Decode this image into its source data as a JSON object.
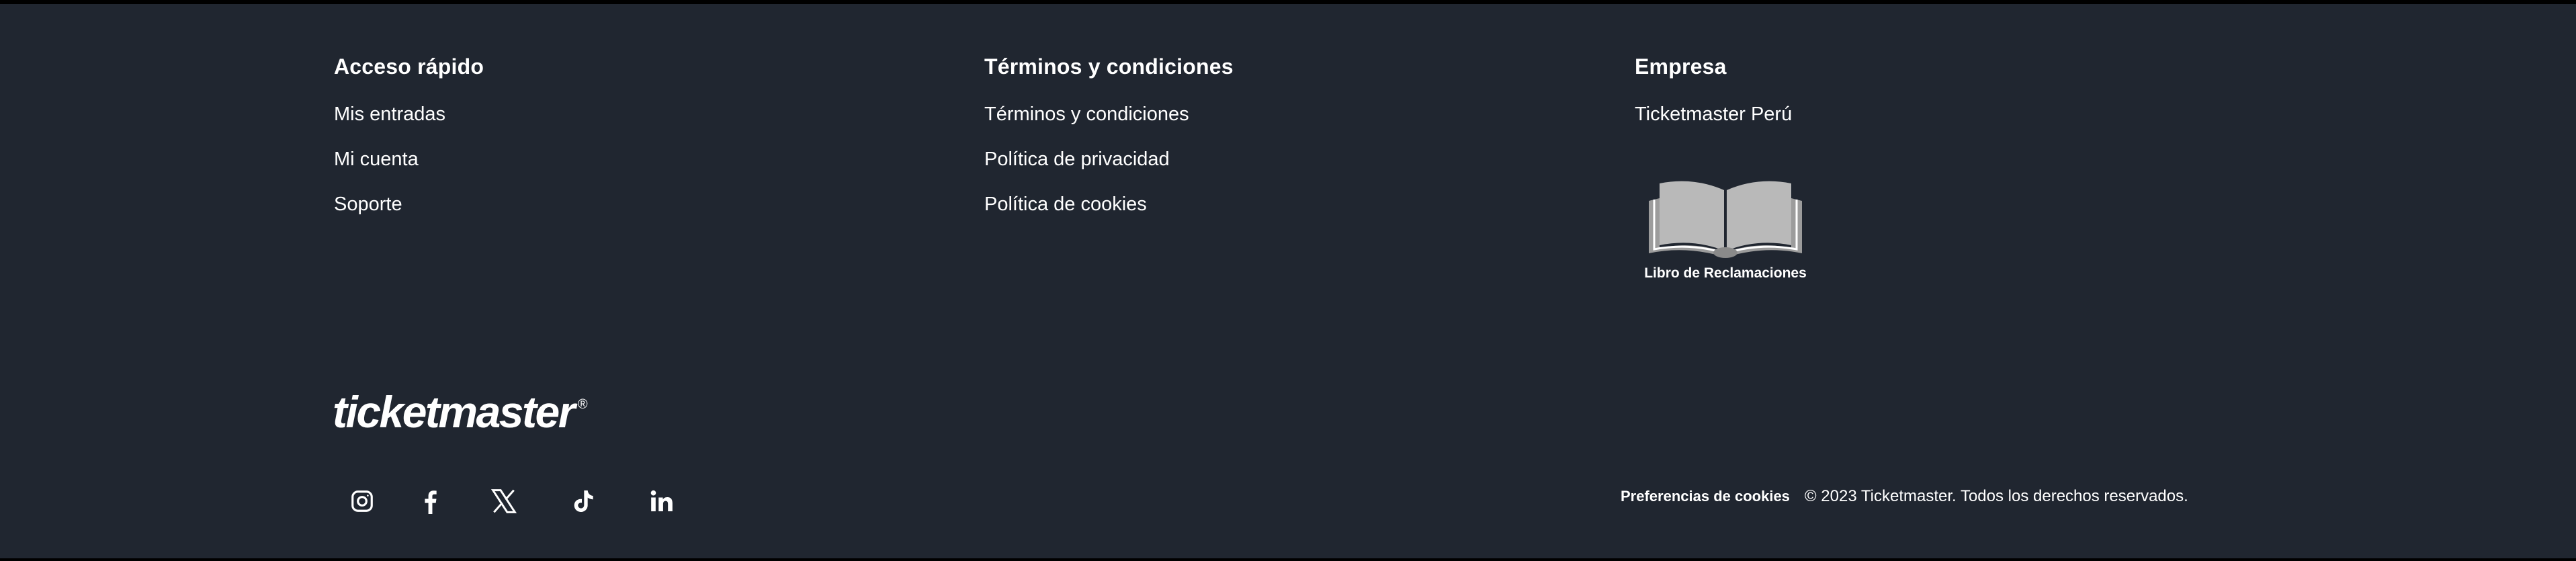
{
  "quick_access": {
    "heading": "Acceso rápido",
    "links": [
      "Mis entradas",
      "Mi cuenta",
      "Soporte"
    ]
  },
  "terms": {
    "heading": "Términos y condiciones",
    "links": [
      "Términos y condiciones",
      "Política de privacidad",
      "Política de cookies"
    ]
  },
  "company": {
    "heading": "Empresa",
    "links": [
      "Ticketmaster Perú"
    ],
    "complaints_book_label": "Libro de Reclamaciones",
    "complaints_book_icon": "open-book-icon"
  },
  "brand": {
    "logo_text": "ticketmaster",
    "registered_mark": "®"
  },
  "social_icons": [
    "instagram-icon",
    "facebook-icon",
    "x-twitter-icon",
    "tiktok-icon",
    "linkedin-icon"
  ],
  "bottom": {
    "cookie_preferences": "Preferencias de cookies",
    "copyright": "© 2023 Ticketmaster. Todos los derechos reservados."
  },
  "colors": {
    "footer_background": "#202630",
    "text": "#ffffff",
    "book_icon": "#b9b9b9"
  }
}
